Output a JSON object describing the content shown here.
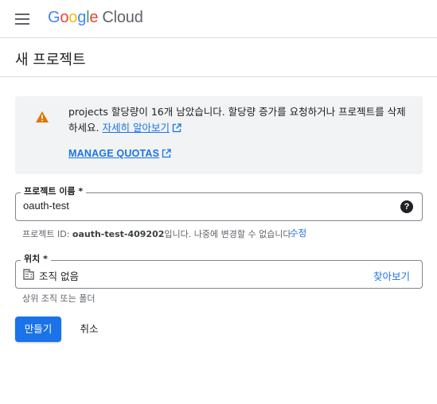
{
  "header": {
    "logo_letters": [
      "G",
      "o",
      "o",
      "g",
      "l",
      "e"
    ],
    "logo_product": "Cloud",
    "menu_icon": "hamburger-menu-icon"
  },
  "page": {
    "title": "새 프로젝트"
  },
  "quota_banner": {
    "icon": "warning-icon",
    "text": "projects 할당량이 16개 남았습니다. 할당량 증가를 요청하거나 프로젝트를 삭제하세요.",
    "learn_more": "자세히 알아보기",
    "manage_quotas": "MANAGE QUOTAS",
    "warning_color": "#e37400"
  },
  "project_name": {
    "label": "프로젝트 이름 *",
    "value": "oauth-test",
    "help_icon": "help-icon"
  },
  "project_id_hint": {
    "prefix": "프로젝트 ID: ",
    "id": "oauth-test-409202",
    "suffix": "입니다. 나중에 변경할 수 없습니다.",
    "edit": "수정"
  },
  "location": {
    "label": "위치 *",
    "value": "조직 없음",
    "browse": "찾아보기",
    "hint": "상위 조직 또는 폴더",
    "icon": "organization-icon"
  },
  "actions": {
    "create": "만들기",
    "cancel": "취소"
  },
  "colors": {
    "accent": "#1a73e8",
    "banner_bg": "#f1f3f4"
  }
}
